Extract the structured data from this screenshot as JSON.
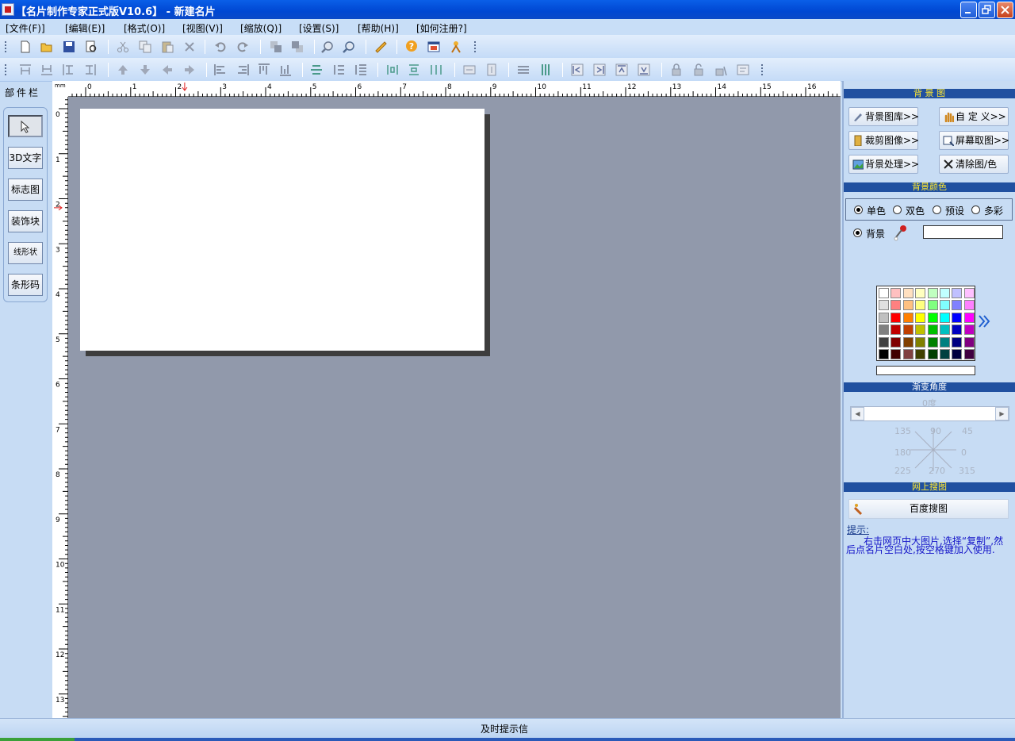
{
  "window": {
    "title": "【名片制作专家正式版V10.6】 - 新建名片"
  },
  "menu": [
    "[文件(F)]",
    "[编辑(E)]",
    "[格式(O)]",
    "[视图(V)]",
    "[缩放(Q)]",
    "[设置(S)]",
    "[帮助(H)]",
    "[如何注册?]"
  ],
  "parts": {
    "title": "部件栏",
    "buttons": [
      "3D文字",
      "标志图",
      "装饰块",
      "线形状",
      "条形码"
    ]
  },
  "ruler": {
    "unit": "mm",
    "top_labels": [
      "0",
      "1",
      "2",
      "3",
      "4",
      "5",
      "6",
      "7",
      "8",
      "9",
      "10",
      "11",
      "12",
      "13",
      "14",
      "15",
      "16"
    ],
    "left_labels": [
      "0",
      "1",
      "2",
      "3",
      "4",
      "5",
      "6",
      "7",
      "8",
      "9",
      "10",
      "11",
      "12",
      "13"
    ]
  },
  "panel": {
    "bg_image": {
      "header": "背 景 图",
      "buttons": [
        "背景图库>>",
        "自 定 义>>",
        "裁剪图像>>",
        "屏幕取图>>",
        "背景处理>>",
        "清除图/色"
      ]
    },
    "bg_color": {
      "header": "背景颜色",
      "modes": [
        "单色",
        "双色",
        "预设",
        "多彩"
      ],
      "selected_mode": "单色",
      "target_label": "背景",
      "value": "",
      "palette": [
        [
          "#ffffff",
          "#ffc0c0",
          "#ffe0c0",
          "#ffffc0",
          "#c0ffc0",
          "#c0ffff",
          "#c0c0ff",
          "#ffc0ff"
        ],
        [
          "#e0e0e0",
          "#ff8080",
          "#ffc080",
          "#ffff80",
          "#80ff80",
          "#80ffff",
          "#8080ff",
          "#ff80ff"
        ],
        [
          "#c0c0c0",
          "#ff0000",
          "#ff8000",
          "#ffff00",
          "#00ff00",
          "#00ffff",
          "#0000ff",
          "#ff00ff"
        ],
        [
          "#808080",
          "#c00000",
          "#c04000",
          "#c0c000",
          "#00c000",
          "#00c0c0",
          "#0000c0",
          "#c000c0"
        ],
        [
          "#404040",
          "#800000",
          "#804000",
          "#808000",
          "#008000",
          "#008080",
          "#000080",
          "#800080"
        ],
        [
          "#000000",
          "#400000",
          "#804040",
          "#404000",
          "#004000",
          "#004040",
          "#000040",
          "#400040"
        ]
      ]
    },
    "gradient": {
      "header": "渐变角度",
      "value": "0度",
      "angles": [
        "135",
        "90",
        "45",
        "180",
        "0",
        "225",
        "270",
        "315"
      ]
    },
    "web_search": {
      "header": "网上搜图",
      "button": "百度搜图",
      "tip_title": "提示:",
      "tip_text": "右击网页中大图片,选择“复制”,然后点名片空白处,按空格键加入使用."
    }
  },
  "status": {
    "text": "及时提示信"
  }
}
